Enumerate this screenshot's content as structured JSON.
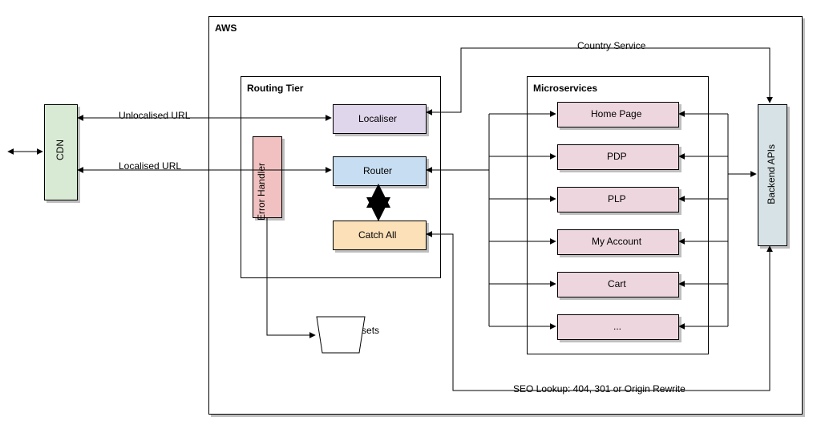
{
  "containers": {
    "aws_title": "AWS",
    "routing_tier_title": "Routing Tier",
    "microservices_title": "Microservices"
  },
  "nodes": {
    "cdn": "CDN",
    "localiser": "Localiser",
    "error_handler": "Error\nHandler",
    "router": "Router",
    "catch_all": "Catch All",
    "static_assets": "Static\nassets",
    "backend_apis": "Backend APIs"
  },
  "microservices": [
    "Home Page",
    "PDP",
    "PLP",
    "My Account",
    "Cart",
    "..."
  ],
  "edges": {
    "unlocalised_url": "Unlocalised URL",
    "localised_url": "Localised URL",
    "country_service": "Country Service",
    "seo_lookup": "SEO Lookup: 404, 301 or Origin Rewrite"
  },
  "colors": {
    "cdn": "#d8ead4",
    "localiser": "#e0d6ec",
    "error_handler": "#f0c1c0",
    "router": "#c7ddf1",
    "catch_all": "#fbe0b8",
    "microservice": "#edd6de",
    "backend": "#d7e2e6"
  }
}
